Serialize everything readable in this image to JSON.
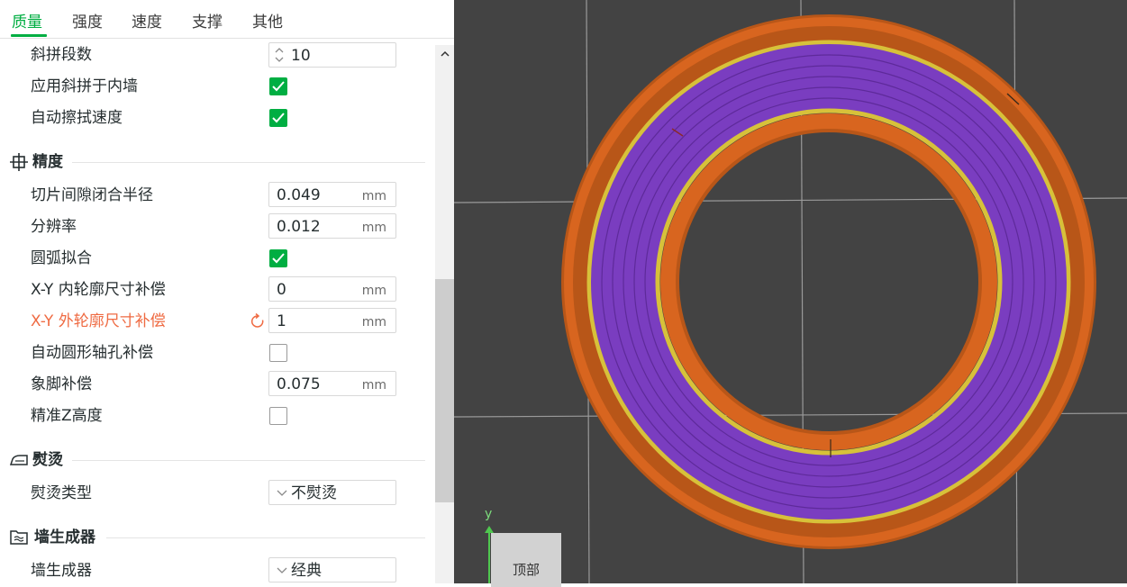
{
  "tabs": [
    {
      "label": "质量",
      "active": true
    },
    {
      "label": "强度",
      "active": false
    },
    {
      "label": "速度",
      "active": false
    },
    {
      "label": "支撑",
      "active": false
    },
    {
      "label": "其他",
      "active": false
    }
  ],
  "top_rows": {
    "slope_steps": {
      "label": "斜拼段数",
      "value": "10"
    },
    "apply_inner": {
      "label": "应用斜拼于内墙",
      "checked": true
    },
    "auto_wipe": {
      "label": "自动擦拭速度",
      "checked": true
    }
  },
  "precision": {
    "title": "精度",
    "icon": "precision-crosshair-icon",
    "slice_gap": {
      "label": "切片间隙闭合半径",
      "value": "0.049",
      "unit": "mm"
    },
    "resolution": {
      "label": "分辨率",
      "value": "0.012",
      "unit": "mm"
    },
    "arc_fitting": {
      "label": "圆弧拟合",
      "checked": true
    },
    "xy_hole": {
      "label": "X-Y 内轮廓尺寸补偿",
      "value": "0",
      "unit": "mm"
    },
    "xy_contour": {
      "label": "X-Y 外轮廓尺寸补偿",
      "value": "1",
      "unit": "mm",
      "modified": true
    },
    "auto_circle": {
      "label": "自动圆形轴孔补偿",
      "checked": false
    },
    "elephant_foot": {
      "label": "象脚补偿",
      "value": "0.075",
      "unit": "mm"
    },
    "precise_z": {
      "label": "精准Z高度",
      "checked": false
    }
  },
  "ironing": {
    "title": "熨烫",
    "icon": "iron-icon",
    "type": {
      "label": "熨烫类型",
      "value": "不熨烫"
    }
  },
  "wall_generator": {
    "title": "墙生成器",
    "icon": "wall-generator-icon",
    "generator": {
      "label": "墙生成器",
      "value": "经典"
    }
  },
  "viewport": {
    "axis_label": "y",
    "view_cube_label": "顶部"
  },
  "colors": {
    "accent": "#00ae42",
    "modified": "#ef6b43",
    "viewport_bg": "#434343",
    "outer_wall": "#d8651f",
    "inner_wall": "#d7c13a",
    "infill": "#7a3dc0"
  }
}
